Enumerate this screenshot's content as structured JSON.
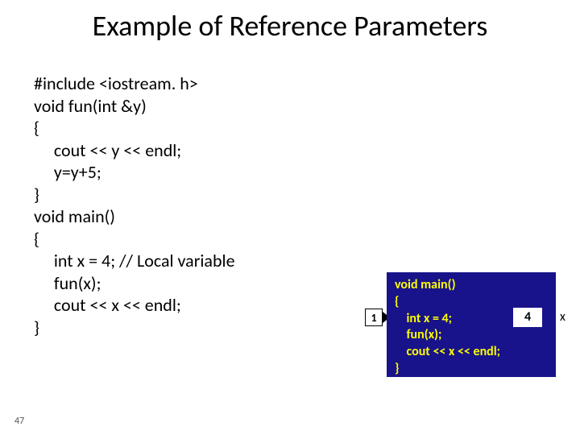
{
  "title": "Example of Reference Parameters",
  "code": "#include <iostream. h>\nvoid fun(int &y)\n{\n     cout << y << endl;\n     y=y+5;\n}\nvoid main()\n{\n     int x = 4; // Local variable\n     fun(x);\n     cout << x << endl;\n}",
  "diagram": {
    "text": "void main()\n{\n    int x = 4;\n    fun(x);\n    cout << x << endl;\n}",
    "var_value": "4",
    "var_label": "x"
  },
  "step": "1",
  "page_num": "47"
}
